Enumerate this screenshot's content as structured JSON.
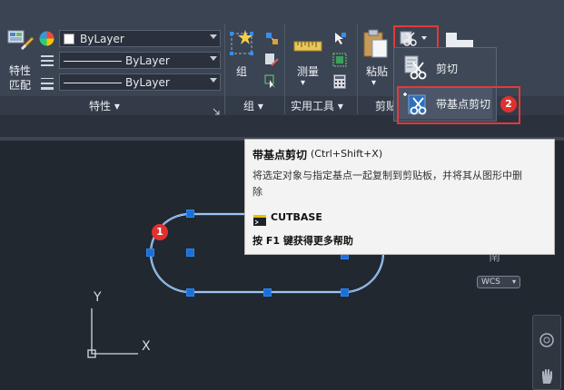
{
  "ribbon": {
    "properties": {
      "match_label_1": "特性",
      "match_label_2": "匹配",
      "color_value": "ByLayer",
      "linetype_value": "ByLayer",
      "lineweight_value": "ByLayer",
      "panel_label": "特性"
    },
    "groups": {
      "group_label": "组",
      "panel_label": "组"
    },
    "utilities": {
      "measure_label": "测量",
      "panel_label": "实用工具"
    },
    "clipboard": {
      "paste_label": "粘贴",
      "panel_label": "剪贴"
    }
  },
  "dropdown": {
    "cut_label": "剪切",
    "cutbase_label": "带基点剪切"
  },
  "tooltip": {
    "title": "带基点剪切",
    "shortcut": "(Ctrl+Shift+X)",
    "description_line1": "将选定对象与指定基点一起复制到剪贴板，并将其从图形中删",
    "description_line2": "除",
    "command": "CUTBASE",
    "help": "按 F1 键获得更多帮助"
  },
  "annotations": {
    "step1": "1",
    "step2": "2"
  },
  "canvas": {
    "ucs_x": "X",
    "ucs_y": "Y",
    "wcs_label": "WCS",
    "cube_fragment": "南"
  },
  "colors": {
    "ribbon_bg": "#3b4453",
    "canvas_bg": "#212830",
    "highlight_red": "#e23a3a",
    "grip_blue": "#1a6fd8",
    "tooltip_bg": "#f3f3f3"
  }
}
